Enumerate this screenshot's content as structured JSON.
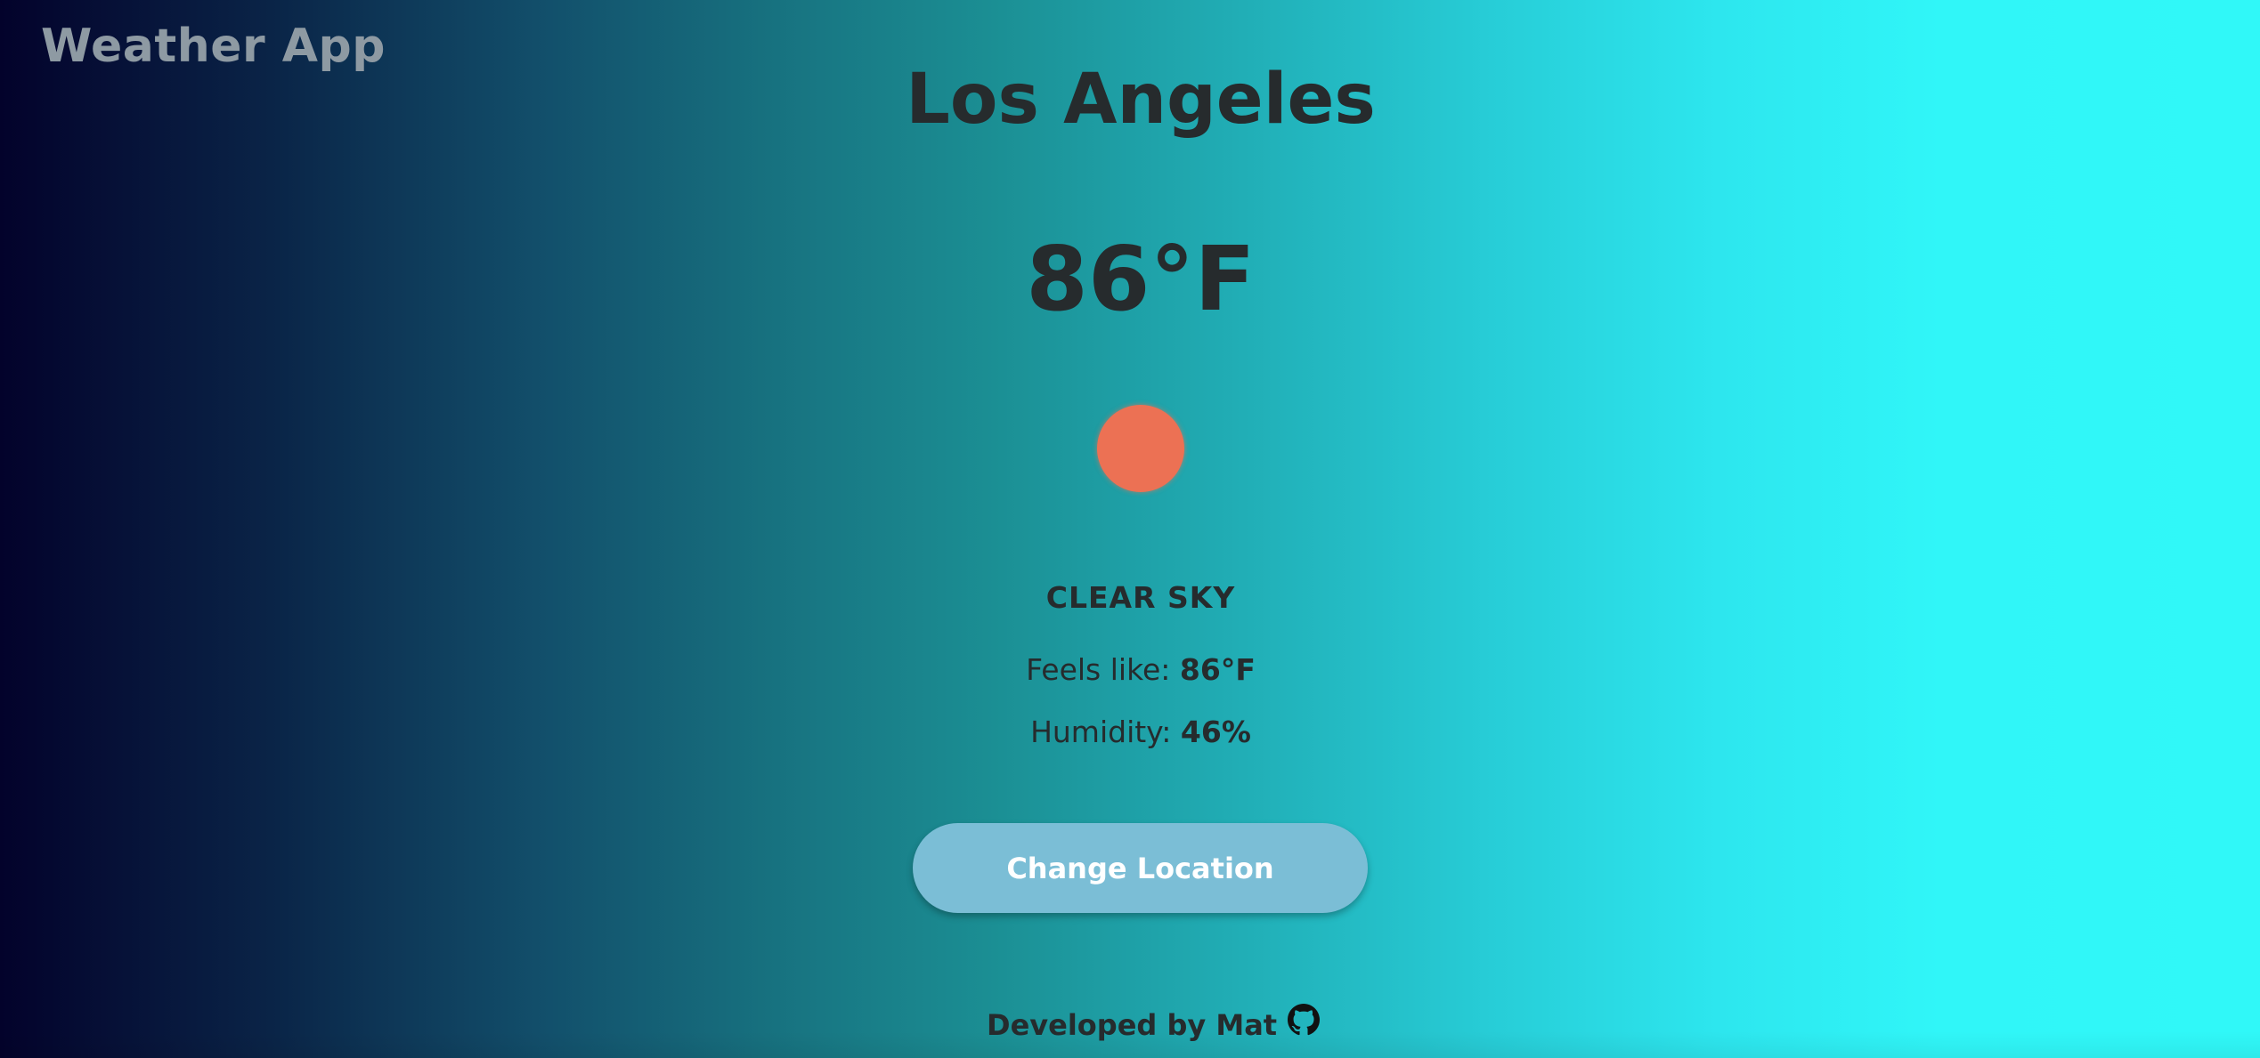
{
  "app": {
    "title": "Weather App"
  },
  "weather": {
    "city": "Los Angeles",
    "temperature": "86°F",
    "condition": "CLEAR SKY",
    "feels_like_label": "Feels like: ",
    "feels_like_value": "86°F",
    "humidity_label": "Humidity: ",
    "humidity_value": "46%",
    "icon": "sun-icon"
  },
  "actions": {
    "change_location_label": "Change Location"
  },
  "footer": {
    "credit": "Developed by Mat",
    "icon": "github-icon"
  },
  "colors": {
    "gradient_start": "#03022b",
    "gradient_end": "#30f8f8",
    "sun": "#ec7154",
    "button": "#7bbed6",
    "text": "#262b2d",
    "app_title": "#8e9aa3"
  }
}
